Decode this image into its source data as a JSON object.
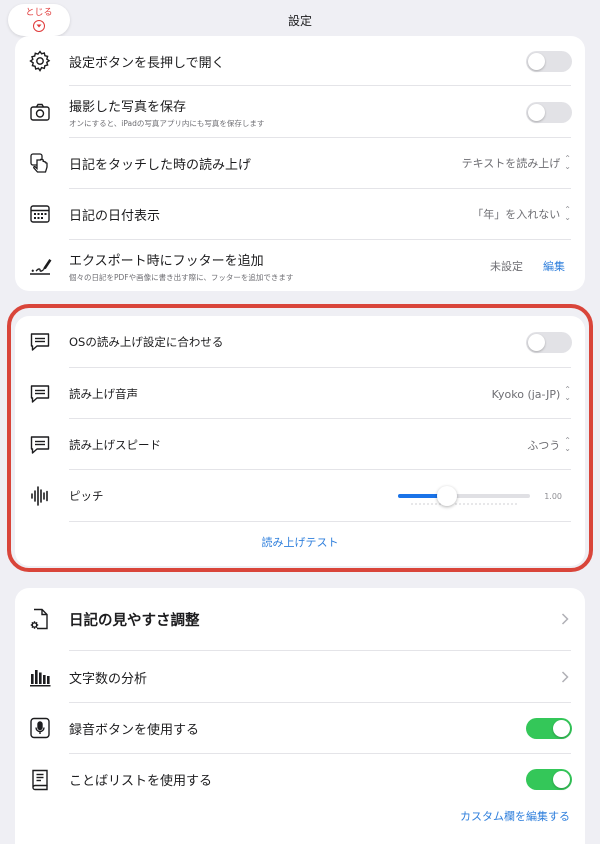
{
  "header": {
    "close_label": "とじる",
    "title": "設定"
  },
  "section1": {
    "rows": [
      {
        "label": "設定ボタンを長押しで開く",
        "icon": "gear-icon",
        "toggle": false
      },
      {
        "label": "撮影した写真を保存",
        "sub": "オンにすると、iPadの写真アプリ内にも写真を保存します",
        "icon": "camera-icon",
        "toggle": false
      },
      {
        "label": "日記をタッチした時の読み上げ",
        "icon": "touch-hand-icon",
        "value": "テキストを読み上げ"
      },
      {
        "label": "日記の日付表示",
        "icon": "calendar-icon",
        "value": "「年」を入れない"
      },
      {
        "label": "エクスポート時にフッターを追加",
        "sub": "個々の日記をPDFや画像に書き出す際に、フッターを追加できます",
        "icon": "signature-icon",
        "value": "未設定",
        "action": "編集"
      }
    ]
  },
  "section2": {
    "rows": [
      {
        "label": "OSの読み上げ設定に合わせる",
        "icon": "speech-bubble-icon",
        "toggle": false
      },
      {
        "label": "読み上げ音声",
        "icon": "speech-bubble-icon",
        "value": "Kyoko (ja-JP)"
      },
      {
        "label": "読み上げスピード",
        "icon": "speech-bubble-icon",
        "value": "ふつう"
      },
      {
        "label": "ピッチ",
        "icon": "waveform-icon",
        "slider_value": "1.00",
        "slider_fraction": 0.37
      }
    ],
    "test_label": "読み上げテスト"
  },
  "section3": {
    "rows": [
      {
        "label": "日記の見やすさ調整",
        "icon": "document-gear-icon"
      },
      {
        "label": "文字数の分析",
        "icon": "bar-chart-icon"
      },
      {
        "label": "録音ボタンを使用する",
        "icon": "microphone-icon",
        "toggle": true
      },
      {
        "label": "ことばリストを使用する",
        "icon": "book-icon",
        "toggle": true
      }
    ],
    "custom_edit_label": "カスタム欄を編集する"
  },
  "colors": {
    "accent": "#2f7fdc",
    "toggle_on": "#34c759",
    "highlight": "#d9453a",
    "close_red": "#e03a3a"
  }
}
